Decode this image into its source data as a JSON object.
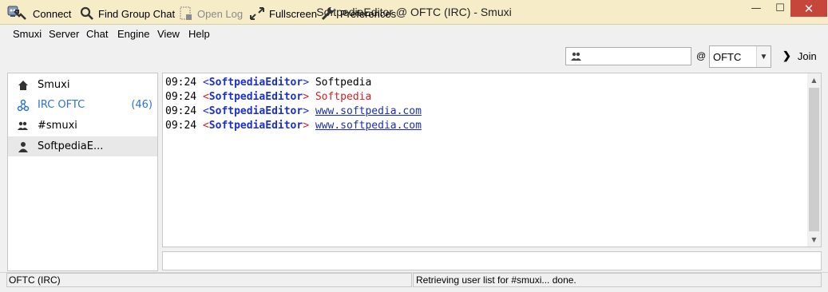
{
  "window": {
    "title": "SoftpediaEditor @ OFTC (IRC) - Smuxi",
    "minimize_glyph": "—",
    "maximize_glyph": "☐",
    "close_glyph": "✕"
  },
  "menu": {
    "items": [
      {
        "label": "Smuxi"
      },
      {
        "label": "Server"
      },
      {
        "label": "Chat"
      },
      {
        "label": "Engine"
      },
      {
        "label": "View"
      },
      {
        "label": "Help"
      }
    ]
  },
  "toolbar": {
    "connect": {
      "label": "Connect",
      "icon": "connect-icon"
    },
    "find_group_chat": {
      "label": "Find Group Chat",
      "icon": "search-icon"
    },
    "open_log": {
      "label": "Open Log",
      "icon": "log-icon",
      "enabled": false
    },
    "fullscreen": {
      "label": "Fullscreen",
      "icon": "fullscreen-icon"
    },
    "preferences": {
      "label": "Preferences",
      "icon": "wrench-icon"
    },
    "nick_input": {
      "value": "",
      "icon": "group-icon"
    },
    "at_symbol": "@",
    "server_select": {
      "value": "OFTC"
    },
    "join": {
      "label": "Join",
      "icon": "chevron-right-icon"
    }
  },
  "sidebar": {
    "items": [
      {
        "label": "Smuxi",
        "icon": "home-icon",
        "count": ""
      },
      {
        "label": "IRC OFTC",
        "icon": "network-icon",
        "count": "(46)"
      },
      {
        "label": "#smuxi",
        "icon": "group-icon",
        "count": ""
      },
      {
        "label": "SoftpediaE...",
        "icon": "person-icon",
        "count": ""
      }
    ]
  },
  "chat": {
    "lines": [
      {
        "time": "09:24",
        "nick": "SoftpediaEditor",
        "message": "Softpedia",
        "style": "normal"
      },
      {
        "time": "09:24",
        "nick": "SoftpediaEditor",
        "message": "Softpedia",
        "style": "highlight"
      },
      {
        "time": "09:24",
        "nick": "SoftpediaEditor",
        "message": "www.softpedia.com",
        "style": "link"
      },
      {
        "time": "09:24",
        "nick": "SoftpediaEditor",
        "message": "www.softpedia.com",
        "style": "link-highlight"
      }
    ]
  },
  "entry": {
    "value": ""
  },
  "status": {
    "left": "OFTC (IRC)",
    "right": "Retrieving user list for #smuxi... done."
  },
  "colors": {
    "titlebar": "#f6ecc8",
    "close_button": "#c7463b",
    "nick": "#1a2fd8",
    "highlight": "#d82020",
    "link": "#1a2fb0",
    "sidebar_link": "#2f72c8"
  }
}
